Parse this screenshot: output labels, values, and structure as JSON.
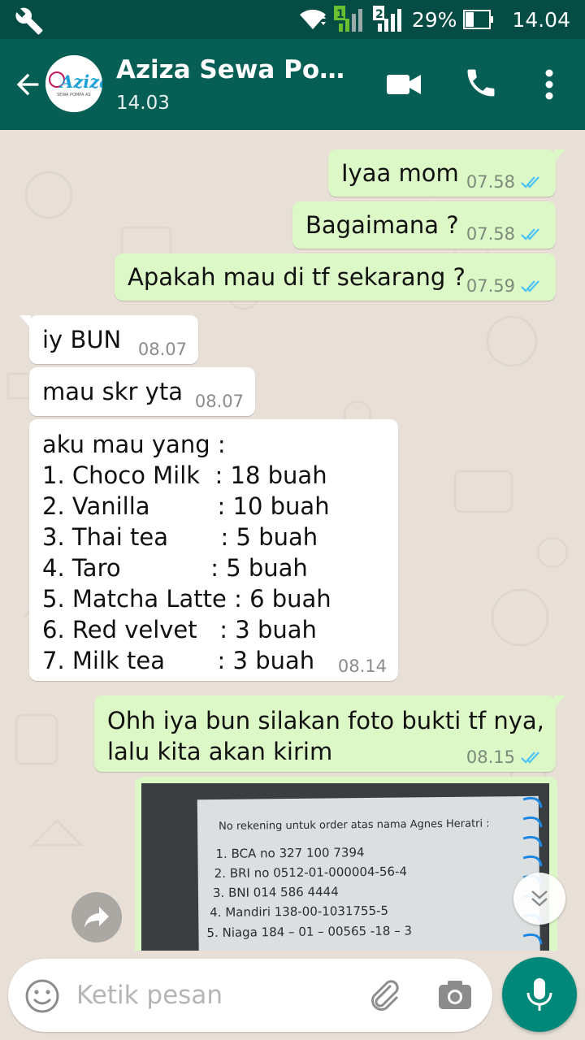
{
  "status_bar": {
    "battery_percent": "29%",
    "time": "14.04",
    "sim1": "1",
    "sim2": "2"
  },
  "header": {
    "title": "Aziza Sewa Pom...",
    "subtitle": "14.03",
    "avatar_text": "Aziza",
    "avatar_subtext": "SEWA POMPA AS"
  },
  "messages": [
    {
      "direction": "out",
      "text": "Iyaa mom",
      "time": "07.58",
      "read": true
    },
    {
      "direction": "out",
      "text": "Bagaimana ?",
      "time": "07.58",
      "read": true
    },
    {
      "direction": "out",
      "text": "Apakah mau di tf sekarang ?",
      "time": "07.59",
      "read": true
    },
    {
      "direction": "in",
      "text": "iy BUN",
      "time": "08.07"
    },
    {
      "direction": "in",
      "text": "mau skr yta",
      "time": "08.07"
    },
    {
      "direction": "in",
      "text": "aku mau yang :\n1. Choco Milk  : 18 buah\n2. Vanilla         : 10 buah\n3. Thai tea       : 5 buah\n4. Taro            : 5 buah\n5. Matcha Latte : 6 buah\n6. Red velvet   : 3 buah\n7. Milk tea       : 3 buah",
      "time": "08.14"
    },
    {
      "direction": "out",
      "text": "Ohh iya bun silakan foto bukti tf nya,\nlalu kita akan kirim",
      "time": "08.15",
      "read": true
    }
  ],
  "photo_message": {
    "heading": "No rekening untuk order atas nama Agnes Heratri :",
    "lines": [
      "1.  BCA  no 327 100 7394",
      "2.  BRI no 0512-01-000004-56-4",
      "3.  BNI 014 586 4444",
      "4.  Mandiri 138-00-1031755-5",
      "5.  Niaga 184 – 01 – 00565 -18 – 3"
    ]
  },
  "input": {
    "placeholder": "Ketik pesan"
  },
  "colors": {
    "header": "#075e54",
    "status_bar": "#054d44",
    "outgoing_bubble": "#dcf8c6",
    "incoming_bubble": "#ffffff",
    "read_tick": "#4fc3f7",
    "mic_button": "#00897b"
  },
  "icons": {
    "status_left": "wrench-icon",
    "back": "arrow-left-icon",
    "video": "video-camera-icon",
    "call": "phone-icon",
    "menu": "more-vert-icon",
    "emoji": "emoji-icon",
    "attach": "paperclip-icon",
    "camera": "camera-icon",
    "mic": "mic-icon",
    "forward": "forward-icon",
    "scroll": "chevron-double-down-icon"
  }
}
